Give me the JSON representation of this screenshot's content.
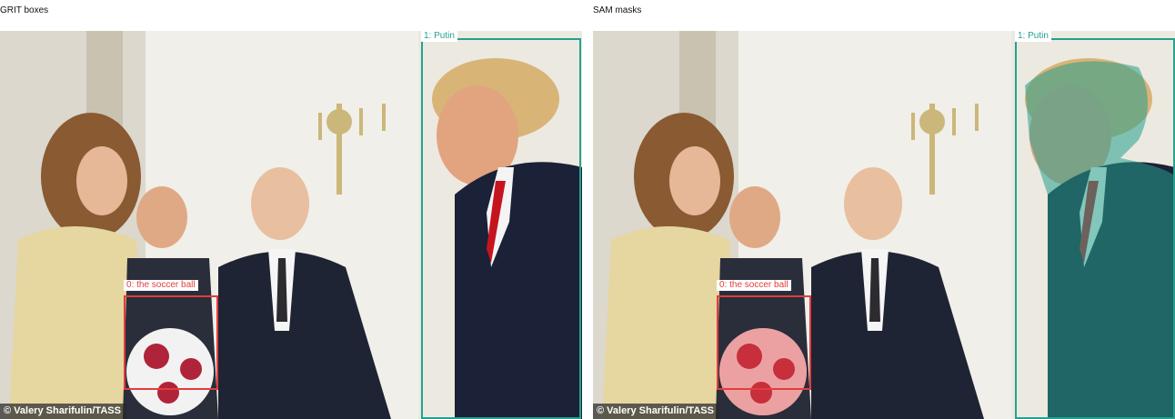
{
  "panels": {
    "left": {
      "title": "GRIT boxes"
    },
    "right": {
      "title": "SAM masks"
    }
  },
  "photo": {
    "credit": "© Valery Sharifulin/TASS"
  },
  "detections": [
    {
      "label": "0: the soccer ball",
      "color": "#e23d3d"
    },
    {
      "label": "1: Putin",
      "color": "#25a18e"
    }
  ]
}
